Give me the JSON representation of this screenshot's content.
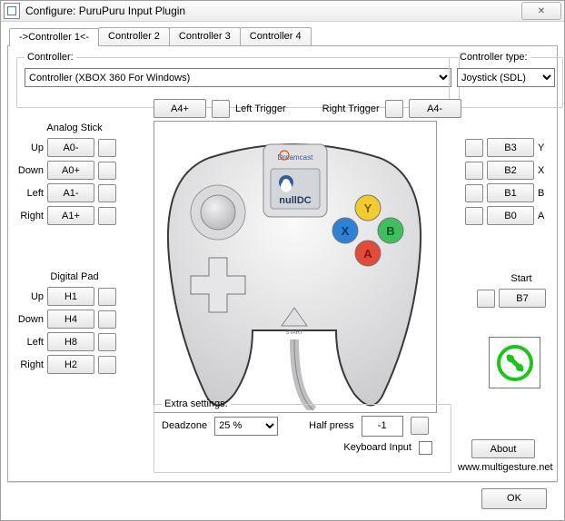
{
  "window": {
    "title": "Configure: PuruPuru Input Plugin",
    "close_glyph": "✕"
  },
  "tabs": [
    "->Controller 1<-",
    "Controller 2",
    "Controller 3",
    "Controller 4"
  ],
  "controller_group": {
    "legend": "Controller:",
    "selected": "Controller (XBOX 360 For Windows)"
  },
  "ctype_group": {
    "legend": "Controller type:",
    "selected": "Joystick (SDL)"
  },
  "triggers": {
    "a4plus": "A4+",
    "left_label": "Left Trigger",
    "right_label": "Right Trigger",
    "a4minus": "A4-"
  },
  "analog": {
    "legend": "Analog Stick",
    "rows": [
      {
        "label": "Up",
        "value": "A0-"
      },
      {
        "label": "Down",
        "value": "A0+"
      },
      {
        "label": "Left",
        "value": "A1-"
      },
      {
        "label": "Right",
        "value": "A1+"
      }
    ]
  },
  "digital": {
    "legend": "Digital Pad",
    "rows": [
      {
        "label": "Up",
        "value": "H1"
      },
      {
        "label": "Down",
        "value": "H4"
      },
      {
        "label": "Left",
        "value": "H8"
      },
      {
        "label": "Right",
        "value": "H2"
      }
    ]
  },
  "face": {
    "rows": [
      {
        "value": "B3",
        "label": "Y"
      },
      {
        "value": "B2",
        "label": "X"
      },
      {
        "value": "B1",
        "label": "B"
      },
      {
        "value": "B0",
        "label": "A"
      }
    ]
  },
  "start": {
    "legend": "Start",
    "value": "B7"
  },
  "extra": {
    "legend": "Extra settings:",
    "deadzone_label": "Deadzone",
    "deadzone_value": "25 %",
    "halfpress_label": "Half press",
    "halfpress_value": "-1",
    "keyboard_label": "Keyboard Input"
  },
  "about": {
    "button": "About",
    "link": "www.multigesture.net"
  },
  "footer": {
    "ok": "OK"
  },
  "image": {
    "brand": "Dreamcast",
    "logo_text": "nullDC"
  }
}
